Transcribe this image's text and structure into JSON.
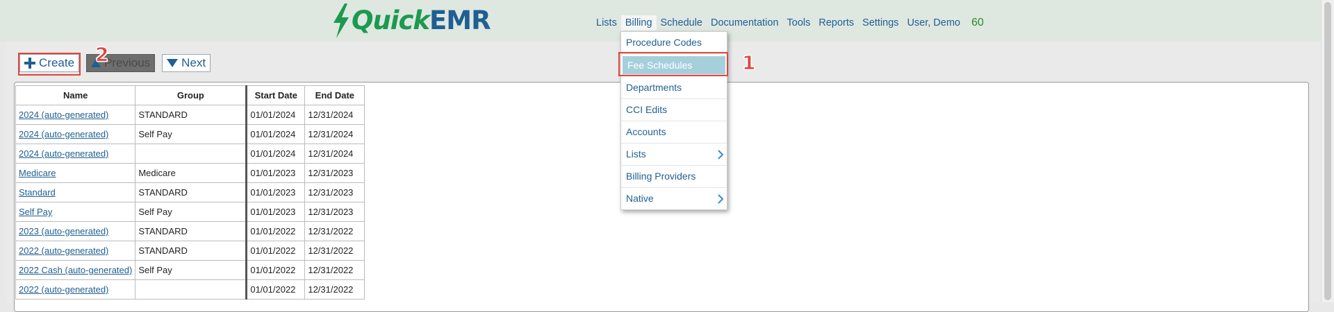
{
  "app": {
    "logo_part1": "Quick",
    "logo_part2": "EMR"
  },
  "topnav": [
    {
      "label": "Lists"
    },
    {
      "label": "Billing"
    },
    {
      "label": "Schedule"
    },
    {
      "label": "Documentation"
    },
    {
      "label": "Tools"
    },
    {
      "label": "Reports"
    },
    {
      "label": "Settings"
    },
    {
      "label": "User, Demo"
    }
  ],
  "counter": "60",
  "toolbar": {
    "create_label": "Create",
    "previous_label": "Previous",
    "next_label": "Next"
  },
  "annotations": {
    "step1": "1",
    "step2": "2"
  },
  "billing_menu": [
    {
      "label": "Procedure Codes"
    },
    {
      "label": "Fee Schedules"
    },
    {
      "label": "Departments"
    },
    {
      "label": "CCI Edits"
    },
    {
      "label": "Accounts"
    },
    {
      "label": "Lists"
    },
    {
      "label": "Billing Providers"
    },
    {
      "label": "Native"
    }
  ],
  "table": {
    "headers": [
      "Name",
      "Group",
      "Start Date",
      "End Date"
    ],
    "rows": [
      {
        "name": "2024 (auto-generated)",
        "group": "STANDARD",
        "start": "01/01/2024",
        "end": "12/31/2024"
      },
      {
        "name": "2024 (auto-generated)",
        "group": "Self Pay",
        "start": "01/01/2024",
        "end": "12/31/2024"
      },
      {
        "name": "2024 (auto-generated)",
        "group": "",
        "start": "01/01/2024",
        "end": "12/31/2024"
      },
      {
        "name": "Medicare",
        "group": "Medicare",
        "start": "01/01/2023",
        "end": "12/31/2023"
      },
      {
        "name": "Standard",
        "group": "STANDARD",
        "start": "01/01/2023",
        "end": "12/31/2023"
      },
      {
        "name": "Self Pay",
        "group": "Self Pay",
        "start": "01/01/2023",
        "end": "12/31/2023"
      },
      {
        "name": "2023 (auto-generated)",
        "group": "STANDARD",
        "start": "01/01/2022",
        "end": "12/31/2022"
      },
      {
        "name": "2022 (auto-generated)",
        "group": "STANDARD",
        "start": "01/01/2022",
        "end": "12/31/2022"
      },
      {
        "name": "2022 Cash (auto-generated)",
        "group": "Self Pay",
        "start": "01/01/2022",
        "end": "12/31/2022"
      },
      {
        "name": "2022 (auto-generated)",
        "group": "",
        "start": "01/01/2022",
        "end": "12/31/2022"
      }
    ]
  },
  "colors": {
    "accent": "#1f5f91",
    "brand_green": "#1b9a4f",
    "callout": "#e0453f",
    "highlight": "#a6cfdc"
  }
}
